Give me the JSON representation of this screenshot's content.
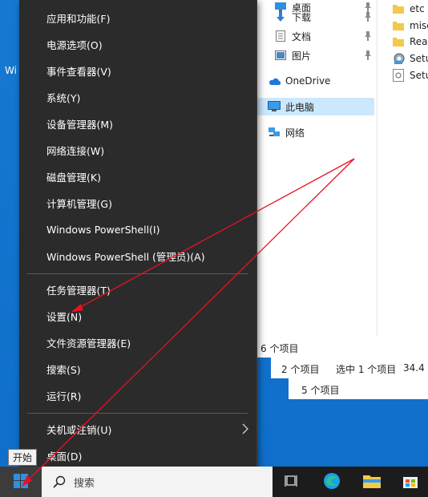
{
  "desktop": {
    "label": "Wi"
  },
  "explorer": {
    "nav": [
      {
        "name": "nav-desktop",
        "label": "桌面",
        "icon": "desktop-folder-icon",
        "pinned": true
      },
      {
        "name": "nav-downloads",
        "label": "下载",
        "icon": "download-arrow-icon",
        "pinned": true
      },
      {
        "name": "nav-documents",
        "label": "文档",
        "icon": "document-icon",
        "pinned": true
      },
      {
        "name": "nav-pictures",
        "label": "图片",
        "icon": "picture-icon",
        "pinned": true
      },
      {
        "name": "nav-onedrive",
        "label": "OneDrive",
        "icon": "cloud-icon"
      },
      {
        "name": "nav-this-pc",
        "label": "此电脑",
        "icon": "computer-icon",
        "selected": true
      },
      {
        "name": "nav-network",
        "label": "网络",
        "icon": "network-icon"
      }
    ],
    "files": [
      {
        "label": "etc",
        "icon": "folder-icon"
      },
      {
        "label": "misc",
        "icon": "folder-icon"
      },
      {
        "label": "Read",
        "icon": "folder-icon"
      },
      {
        "label": "Setu",
        "icon": "setup-gear-icon"
      },
      {
        "label": "Setu",
        "icon": "setup-file-icon"
      }
    ],
    "status_main": "6 个项目",
    "status_back1_count": "2 个项目",
    "status_back1_selected": "选中 1 个项目",
    "status_back1_size": "34.4",
    "status_back2_count": "5 个项目"
  },
  "menu": {
    "items": [
      {
        "label": "应用和功能(F)"
      },
      {
        "label": "电源选项(O)"
      },
      {
        "label": "事件查看器(V)"
      },
      {
        "label": "系统(Y)"
      },
      {
        "label": "设备管理器(M)"
      },
      {
        "label": "网络连接(W)"
      },
      {
        "label": "磁盘管理(K)"
      },
      {
        "label": "计算机管理(G)"
      },
      {
        "label": "Windows PowerShell(I)"
      },
      {
        "label": "Windows PowerShell (管理员)(A)"
      },
      {
        "label": "任务管理器(T)"
      },
      {
        "label": "设置(N)"
      },
      {
        "label": "文件资源管理器(E)"
      },
      {
        "label": "搜索(S)"
      },
      {
        "label": "运行(R)"
      },
      {
        "label": "关机或注销(U)",
        "submenu": true
      },
      {
        "label": "桌面(D)"
      }
    ]
  },
  "tooltip": "开始",
  "taskbar": {
    "search_label": "搜索",
    "icons": [
      "task-view-icon",
      "edge-icon",
      "file-explorer-icon",
      "store-icon"
    ]
  },
  "colors": {
    "accent": "#0078d4",
    "menu_bg": "#2b2b2b",
    "arrow": "#e81123",
    "selected": "#cce8ff"
  }
}
